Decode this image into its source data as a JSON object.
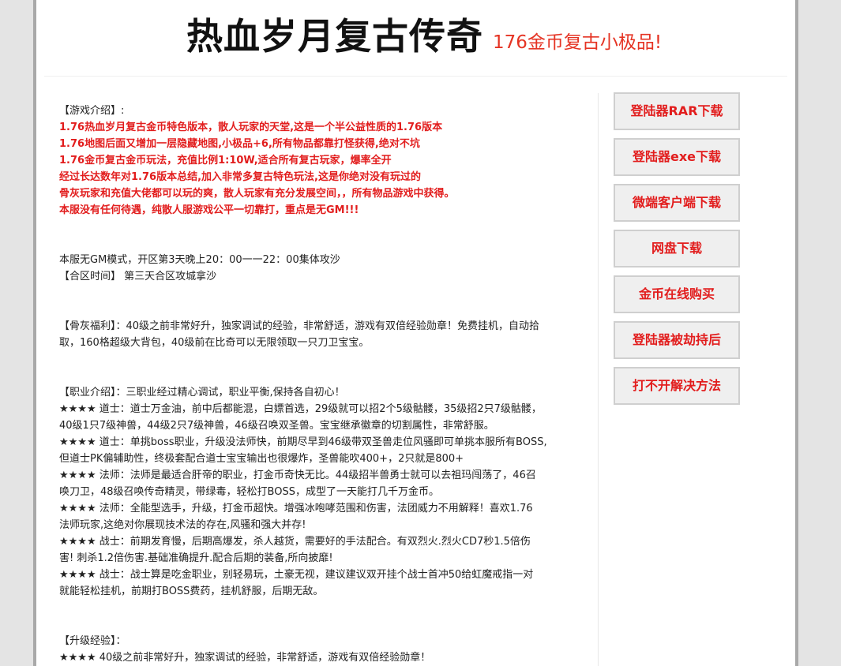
{
  "header": {
    "title": "热血岁月复古传奇",
    "tagline": "176金币复古小极品!"
  },
  "intro": {
    "heading": "【游戏介绍】:",
    "lines": [
      "1.76热血岁月复古金币特色版本，散人玩家的天堂,这是一个半公益性质的1.76版本",
      "1.76地图后面又增加一层隐藏地图,小极品+6,所有物品都靠打怪获得,绝对不坑",
      "1.76金币复古金币玩法，充值比例1:10W,适合所有复古玩家，爆率全开",
      "经过长达数年对1.76版本总结,加入非常多复古特色玩法,这是你绝对没有玩过的",
      "骨灰玩家和充值大佬都可以玩的爽，散人玩家有充分发展空间，，所有物品游戏中获得。",
      "本服没有任何待遇，纯散人服游戏公平一切靠打，重点是无GM!!!"
    ]
  },
  "schedule": {
    "line1": "本服无GM模式，开区第3天晚上20：00一一22：00集体攻沙",
    "line2": "【合区时间】 第三天合区攻城拿沙"
  },
  "welfare": {
    "line1": "【骨灰福利】：40级之前非常好升，独家调试的经验，非常舒适，游戏有双倍经验勋章！免费挂机，自动拾",
    "line2": "取，160格超级大背包，40级前在比奇可以无限领取一只刀卫宝宝。"
  },
  "classes": {
    "heading": "【职业介绍】：三职业经过精心调试，职业平衡,保持各自初心！",
    "lines": [
      "★★★★ 道士：道士万金油，前中后都能混，白嫖首选，29级就可以招2个5级骷髅，35级招2只7级骷髅，",
      "40级1只7级神兽，44级2只7级神兽，46级召唤双圣兽。宝宝继承徽章的切割属性，非常舒服。",
      "★★★★ 道士：单挑boss职业，升级没法师快，前期尽早到46级带双圣兽走位风骚即可单挑本服所有BOSS,",
      "但道士PK偏辅助性，终极套配合道士宝宝输出也很爆炸，圣兽能吹400+，2只就是800+",
      "★★★★ 法师：法师是最适合肝帝的职业，打金币奇快无比。44级招半兽勇士就可以去祖玛闯荡了，46召",
      "唤刀卫，48级召唤传奇精灵，带绿毒，轻松打BOSS，成型了一天能打几千万金币。",
      "★★★★ 法师：全能型选手，升级，打金币超快。增强冰咆哮范围和伤害，法团威力不用解释！喜欢1.76",
      "法师玩家,这绝对你展现技术法的存在,风骚和强大并存!",
      "★★★★ 战士：前期发育慢，后期高爆发，杀人越货，需要好的手法配合。有双烈火.烈火CD7秒1.5倍伤",
      "害! 刺杀1.2倍伤害.基础准确提升.配合后期的装备,所向披靡!",
      "★★★★ 战士：战士算是吃金职业，别轻易玩，土豪无视，建议建议双开挂个战士首冲50给虹魔戒指一对",
      "就能轻松挂机，前期打BOSS费药，挂机舒服，后期无敌。"
    ]
  },
  "leveling": {
    "heading": "【升级经验】：",
    "line1": "★★★★ 40级之前非常好升，独家调试的经验，非常舒适，游戏有双倍经验勋章！"
  },
  "sidebar": {
    "buttons": [
      "登陆器RAR下载",
      "登陆器exe下载",
      "微端客户端下载",
      "网盘下载",
      "金币在线购买",
      "登陆器被劫持后",
      "打不开解决方法"
    ]
  },
  "colors": {
    "accent_red": "#e21d1d",
    "tagline_red": "#e53323",
    "button_bg": "#efefef",
    "frame_gray": "#a9a9a9"
  }
}
